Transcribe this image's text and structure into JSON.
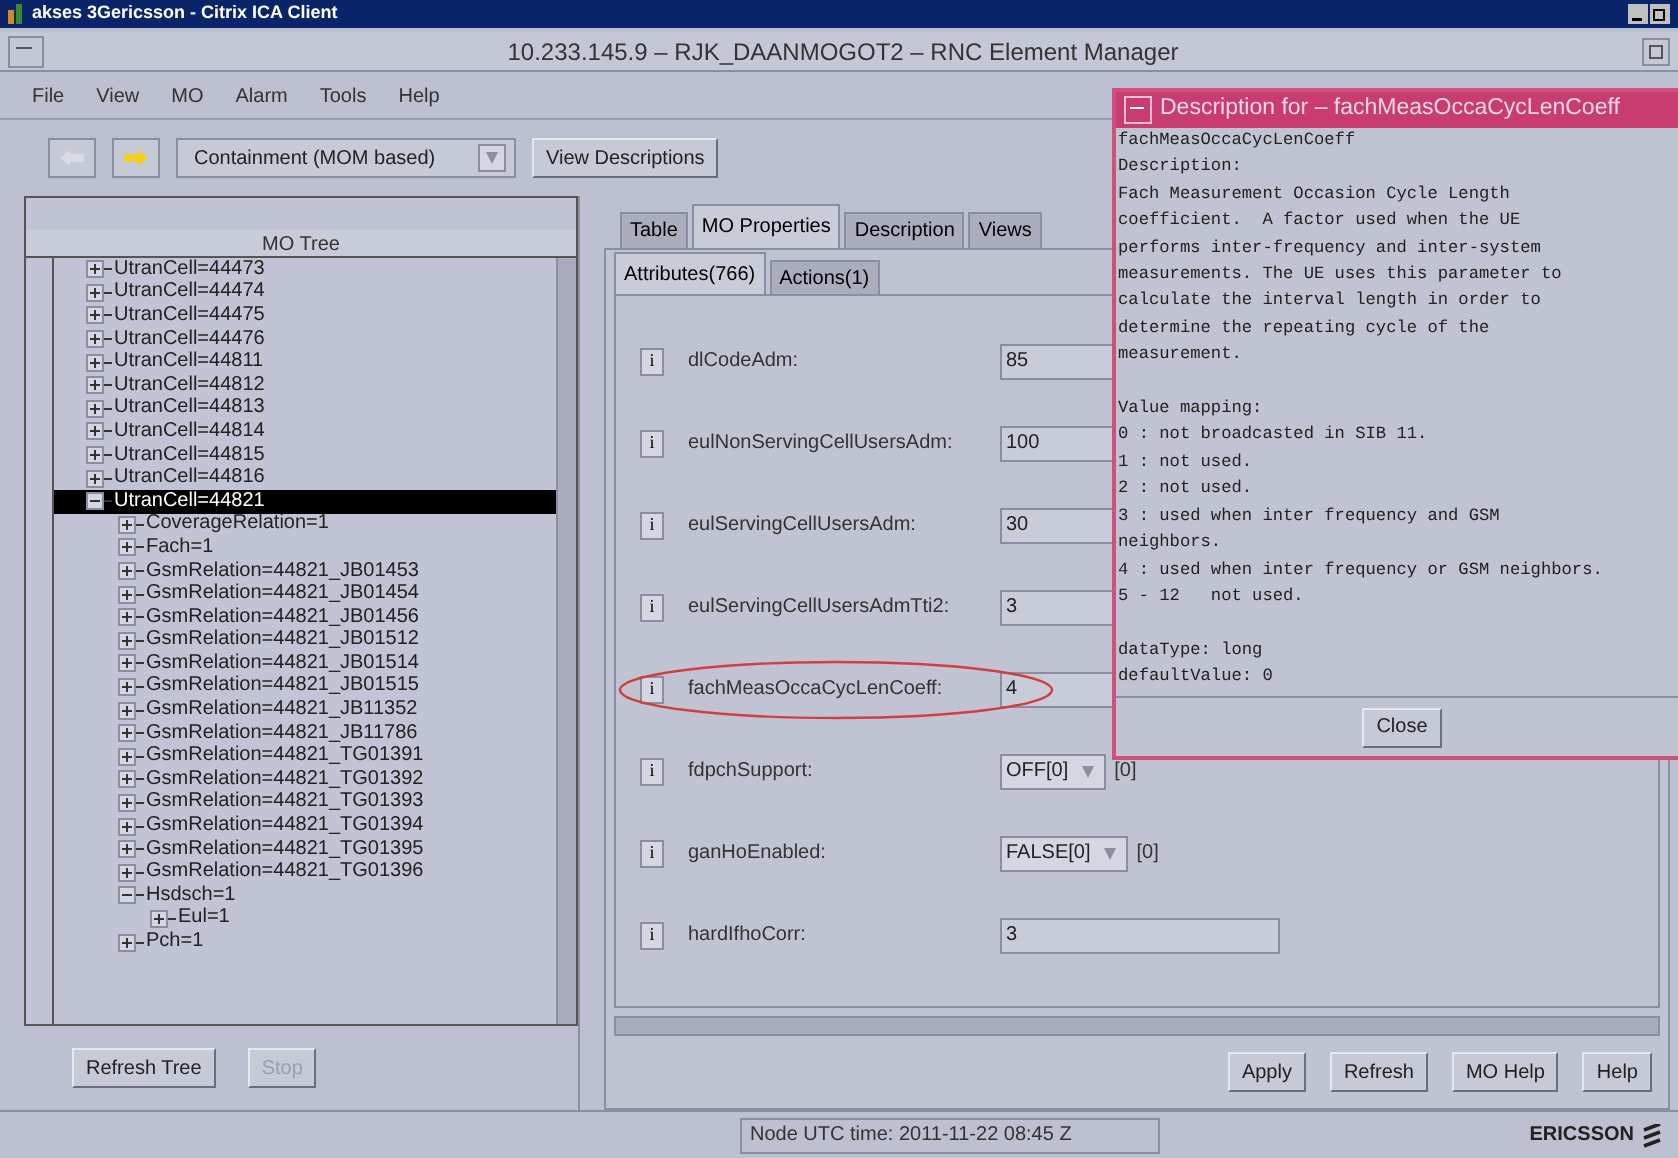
{
  "client_title": "akses 3Gericsson - Citrix ICA Client",
  "window": {
    "title": "10.233.145.9 – RJK_DAANMOGOT2 – RNC Element Manager"
  },
  "menu": [
    "File",
    "View",
    "MO",
    "Alarm",
    "Tools",
    "Help"
  ],
  "toolbar": {
    "back_disabled": true,
    "forward_disabled": false,
    "view_select": "Containment (MOM based)",
    "view_descriptions": "View Descriptions"
  },
  "tree": {
    "title": "MO Tree",
    "items": [
      {
        "label": "UtranCell=44473",
        "expanded": false,
        "selected": false
      },
      {
        "label": "UtranCell=44474",
        "expanded": false,
        "selected": false
      },
      {
        "label": "UtranCell=44475",
        "expanded": false,
        "selected": false
      },
      {
        "label": "UtranCell=44476",
        "expanded": false,
        "selected": false
      },
      {
        "label": "UtranCell=44811",
        "expanded": false,
        "selected": false
      },
      {
        "label": "UtranCell=44812",
        "expanded": false,
        "selected": false
      },
      {
        "label": "UtranCell=44813",
        "expanded": false,
        "selected": false
      },
      {
        "label": "UtranCell=44814",
        "expanded": false,
        "selected": false
      },
      {
        "label": "UtranCell=44815",
        "expanded": false,
        "selected": false
      },
      {
        "label": "UtranCell=44816",
        "expanded": false,
        "selected": false
      },
      {
        "label": "UtranCell=44821",
        "expanded": true,
        "selected": true,
        "children": [
          {
            "label": "CoverageRelation=1",
            "expanded": false,
            "selected": false
          },
          {
            "label": "Fach=1",
            "expanded": false,
            "selected": false
          },
          {
            "label": "GsmRelation=44821_JB01453",
            "expanded": false,
            "selected": false
          },
          {
            "label": "GsmRelation=44821_JB01454",
            "expanded": false,
            "selected": false
          },
          {
            "label": "GsmRelation=44821_JB01456",
            "expanded": false,
            "selected": false
          },
          {
            "label": "GsmRelation=44821_JB01512",
            "expanded": false,
            "selected": false
          },
          {
            "label": "GsmRelation=44821_JB01514",
            "expanded": false,
            "selected": false
          },
          {
            "label": "GsmRelation=44821_JB01515",
            "expanded": false,
            "selected": false
          },
          {
            "label": "GsmRelation=44821_JB11352",
            "expanded": false,
            "selected": false
          },
          {
            "label": "GsmRelation=44821_JB11786",
            "expanded": false,
            "selected": false
          },
          {
            "label": "GsmRelation=44821_TG01391",
            "expanded": false,
            "selected": false
          },
          {
            "label": "GsmRelation=44821_TG01392",
            "expanded": false,
            "selected": false
          },
          {
            "label": "GsmRelation=44821_TG01393",
            "expanded": false,
            "selected": false
          },
          {
            "label": "GsmRelation=44821_TG01394",
            "expanded": false,
            "selected": false
          },
          {
            "label": "GsmRelation=44821_TG01395",
            "expanded": false,
            "selected": false
          },
          {
            "label": "GsmRelation=44821_TG01396",
            "expanded": false,
            "selected": false
          },
          {
            "label": "Hsdsch=1",
            "expanded": true,
            "selected": false,
            "children": [
              {
                "label": "Eul=1",
                "expanded": false,
                "selected": false
              }
            ]
          },
          {
            "label": "Pch=1",
            "expanded": false,
            "selected": false
          }
        ]
      }
    ],
    "buttons": [
      {
        "label": "Refresh Tree",
        "disabled": false
      },
      {
        "label": "Stop",
        "disabled": true
      }
    ]
  },
  "tabs": [
    {
      "label": "Table",
      "selected": false
    },
    {
      "label": "MO Properties",
      "selected": true
    },
    {
      "label": "Description",
      "selected": false
    },
    {
      "label": "Views",
      "selected": false
    }
  ],
  "subtabs": [
    {
      "label": "Attributes(766)",
      "selected": true
    },
    {
      "label": "Actions(1)",
      "selected": false
    }
  ],
  "attributes": [
    {
      "info": "i",
      "name": "dlCodeAdm:",
      "kind": "text",
      "value": "85",
      "highlighted": false
    },
    {
      "info": "i",
      "name": "eulNonServingCellUsersAdm:",
      "kind": "text",
      "value": "100",
      "highlighted": false
    },
    {
      "info": "i",
      "name": "eulServingCellUsersAdm:",
      "kind": "text",
      "value": "30",
      "highlighted": false
    },
    {
      "info": "i",
      "name": "eulServingCellUsersAdmTti2:",
      "kind": "text",
      "value": "3",
      "highlighted": false
    },
    {
      "info": "i",
      "name": "fachMeasOccaCycLenCoeff:",
      "kind": "text",
      "value": "4",
      "highlighted": true
    },
    {
      "info": "i",
      "name": "fdpchSupport:",
      "kind": "select",
      "value": "OFF[0]",
      "current": "[0]",
      "highlighted": false
    },
    {
      "info": "i",
      "name": "ganHoEnabled:",
      "kind": "select",
      "value": "FALSE[0]",
      "current": "[0]",
      "highlighted": false
    },
    {
      "info": "i",
      "name": "hardIfhoCorr:",
      "kind": "text",
      "value": "3",
      "highlighted": false
    }
  ],
  "actions": [
    {
      "label": "Apply"
    },
    {
      "label": "Refresh"
    },
    {
      "label": "MO Help"
    },
    {
      "label": "Help"
    }
  ],
  "status_bar": {
    "time": "Node UTC time: 2011-11-22 08:45 Z",
    "brand": "ERICSSON"
  },
  "dialog": {
    "title": "Description for – fachMeasOccaCycLenCoeff",
    "text": "fachMeasOccaCycLenCoeff\nDescription:\nFach Measurement Occasion Cycle Length\ncoefficient.  A factor used when the UE\nperforms inter-frequency and inter-system\nmeasurements. The UE uses this parameter to\ncalculate the interval length in order to\ndetermine the repeating cycle of the\nmeasurement.\n\nValue mapping:\n0 : not broadcasted in SIB 11.\n1 : not used.\n2 : not used.\n3 : used when inter frequency and GSM\nneighbors.\n4 : used when inter frequency or GSM neighbors.\n5 - 12   not used.\n\ndataType: long\ndefaultValue: 0",
    "close": "Close"
  }
}
